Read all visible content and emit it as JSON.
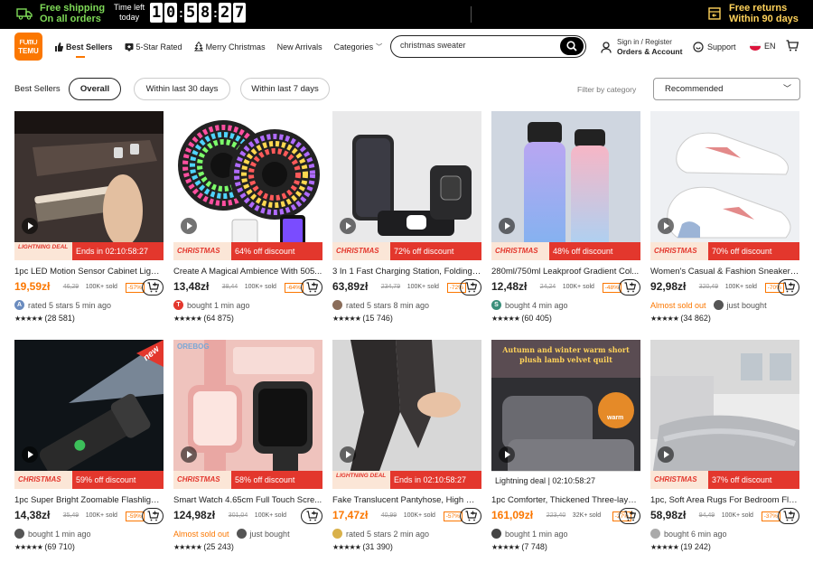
{
  "topbar": {
    "shipping_line1": "Free shipping",
    "shipping_line2": "On all orders",
    "timer_label1": "Time left",
    "timer_label2": "today",
    "timer_digits": [
      "1",
      "0",
      "5",
      "8",
      "2",
      "7"
    ],
    "returns_line1": "Free returns",
    "returns_line2": "Within 90 days"
  },
  "header": {
    "logo_line1": "ᖴᑌᗰᑌ",
    "logo_line2": "TEMU",
    "nav": [
      {
        "label": "Best Sellers",
        "icon": "thumbs-up-icon"
      },
      {
        "label": "5-Star Rated",
        "icon": "star-badge-icon"
      },
      {
        "label": "Merry Christmas",
        "icon": "christmas-tree-icon"
      },
      {
        "label": "New Arrivals",
        "icon": ""
      },
      {
        "label": "Categories",
        "icon": "chevron-down-icon"
      }
    ],
    "search_value": "christmas sweater",
    "signin_line1": "Sign in / Register",
    "signin_line2": "Orders & Account",
    "support": "Support",
    "lang": "EN"
  },
  "filters": {
    "label": "Best Sellers",
    "pills": [
      "Overall",
      "Within last 30 days",
      "Within last 7 days"
    ],
    "filter_by": "Filter by category",
    "sort": "Recommended"
  },
  "colors": {
    "accent": "#fb7701",
    "sale_red": "#e3372d",
    "badge_bg": "#fbe6d7"
  },
  "products": [
    {
      "title": "1pc LED Motion Sensor Cabinet Light,...",
      "price": "19,59zł",
      "price_orange": true,
      "old": "46,29",
      "sold": "100K+ sold",
      "disc": "-57%",
      "badge_tag": "LIGHTNING DEAL",
      "badge_text": "Ends in 02:10:58:27",
      "social": "rated 5 stars 5 min ago",
      "social_orange": false,
      "avatar": "A",
      "rating_count": "(28 581)"
    },
    {
      "title": "Create A Magical Ambience With 505...",
      "price": "13,48zł",
      "price_orange": false,
      "old": "38,44",
      "sold": "100K+ sold",
      "disc": "-64%",
      "badge_tag": "CHRISTMAS",
      "badge_text": "64% off discount",
      "social": "bought 1 min ago",
      "social_orange": false,
      "avatar": "T",
      "rating_count": "(64 875)"
    },
    {
      "title": "3 In 1 Fast Charging Station, Folding ...",
      "price": "63,89zł",
      "price_orange": false,
      "old": "234,79",
      "sold": "100K+ sold",
      "disc": "-72%",
      "badge_tag": "CHRISTMAS",
      "badge_text": "72% off discount",
      "social": "rated 5 stars 8 min ago",
      "social_orange": false,
      "avatar": "",
      "rating_count": "(15 746)"
    },
    {
      "title": "280ml/750ml Leakproof Gradient Col...",
      "price": "12,48zł",
      "price_orange": false,
      "old": "24,24",
      "sold": "100K+ sold",
      "disc": "-48%",
      "badge_tag": "CHRISTMAS",
      "badge_text": "48% off discount",
      "social": "bought 4 min ago",
      "social_orange": false,
      "avatar": "S",
      "rating_count": "(60 405)"
    },
    {
      "title": "Women's Casual & Fashion Sneakers,...",
      "price": "92,98zł",
      "price_orange": false,
      "old": "320,49",
      "sold": "100K+ sold",
      "disc": "-70%",
      "badge_tag": "CHRISTMAS",
      "badge_text": "70% off discount",
      "social": "Almost sold out",
      "social_orange": true,
      "social2": "just bought",
      "avatar": "",
      "rating_count": "(34 862)"
    },
    {
      "title": "1pc Super Bright Zoomable Flashlight...",
      "price": "14,38zł",
      "price_orange": false,
      "old": "35,49",
      "sold": "100K+ sold",
      "disc": "-59%",
      "badge_tag": "CHRISTMAS",
      "badge_text": "59% off discount",
      "social": "bought 1 min ago",
      "social_orange": false,
      "avatar": "",
      "rating_count": "(69 710)"
    },
    {
      "title": "Smart Watch 4.65cm Full Touch Scre...",
      "price": "124,98zł",
      "price_orange": false,
      "old": "301,04",
      "sold": "100K+ sold",
      "disc": "",
      "badge_tag": "CHRISTMAS",
      "badge_text": "58% off discount",
      "social": "Almost sold out",
      "social_orange": true,
      "social2": "just bought",
      "avatar": "",
      "rating_count": "(25 243)"
    },
    {
      "title": "Fake Translucent Pantyhose, High Wa...",
      "price": "17,47zł",
      "price_orange": true,
      "old": "40,99",
      "sold": "100K+ sold",
      "disc": "-57%",
      "badge_tag": "LIGHTNING DEAL",
      "badge_text": "Ends in 02:10:58:27",
      "social": "rated 5 stars 2 min ago",
      "social_orange": false,
      "avatar": "",
      "rating_count": "(31 390)"
    },
    {
      "title": "1pc Comforter, Thickened Three-layer...",
      "price": "161,09zł",
      "price_orange": true,
      "old": "223,40",
      "sold": "32K+ sold",
      "disc": "-27%",
      "badge_tag": "Lightning deal",
      "badge_text": "02:10:58:27",
      "social": "bought 1 min ago",
      "social_orange": false,
      "avatar": "",
      "rating_count": "(7 748)"
    },
    {
      "title": "1pc, Soft Area Rugs For Bedroom Fluf...",
      "price": "58,98zł",
      "price_orange": false,
      "old": "94,49",
      "sold": "100K+ sold",
      "disc": "-37%",
      "badge_tag": "CHRISTMAS",
      "badge_text": "37% off discount",
      "social": "bought 6 min ago",
      "social_orange": false,
      "avatar": "",
      "rating_count": "(19 242)"
    }
  ],
  "image_texts": {
    "flashlight_sticker": "new",
    "watch_brand": "OREBOG",
    "comforter_banner": "Autumn and winter warm short plush lamb velvet quilt",
    "comforter_warm": "warm"
  }
}
